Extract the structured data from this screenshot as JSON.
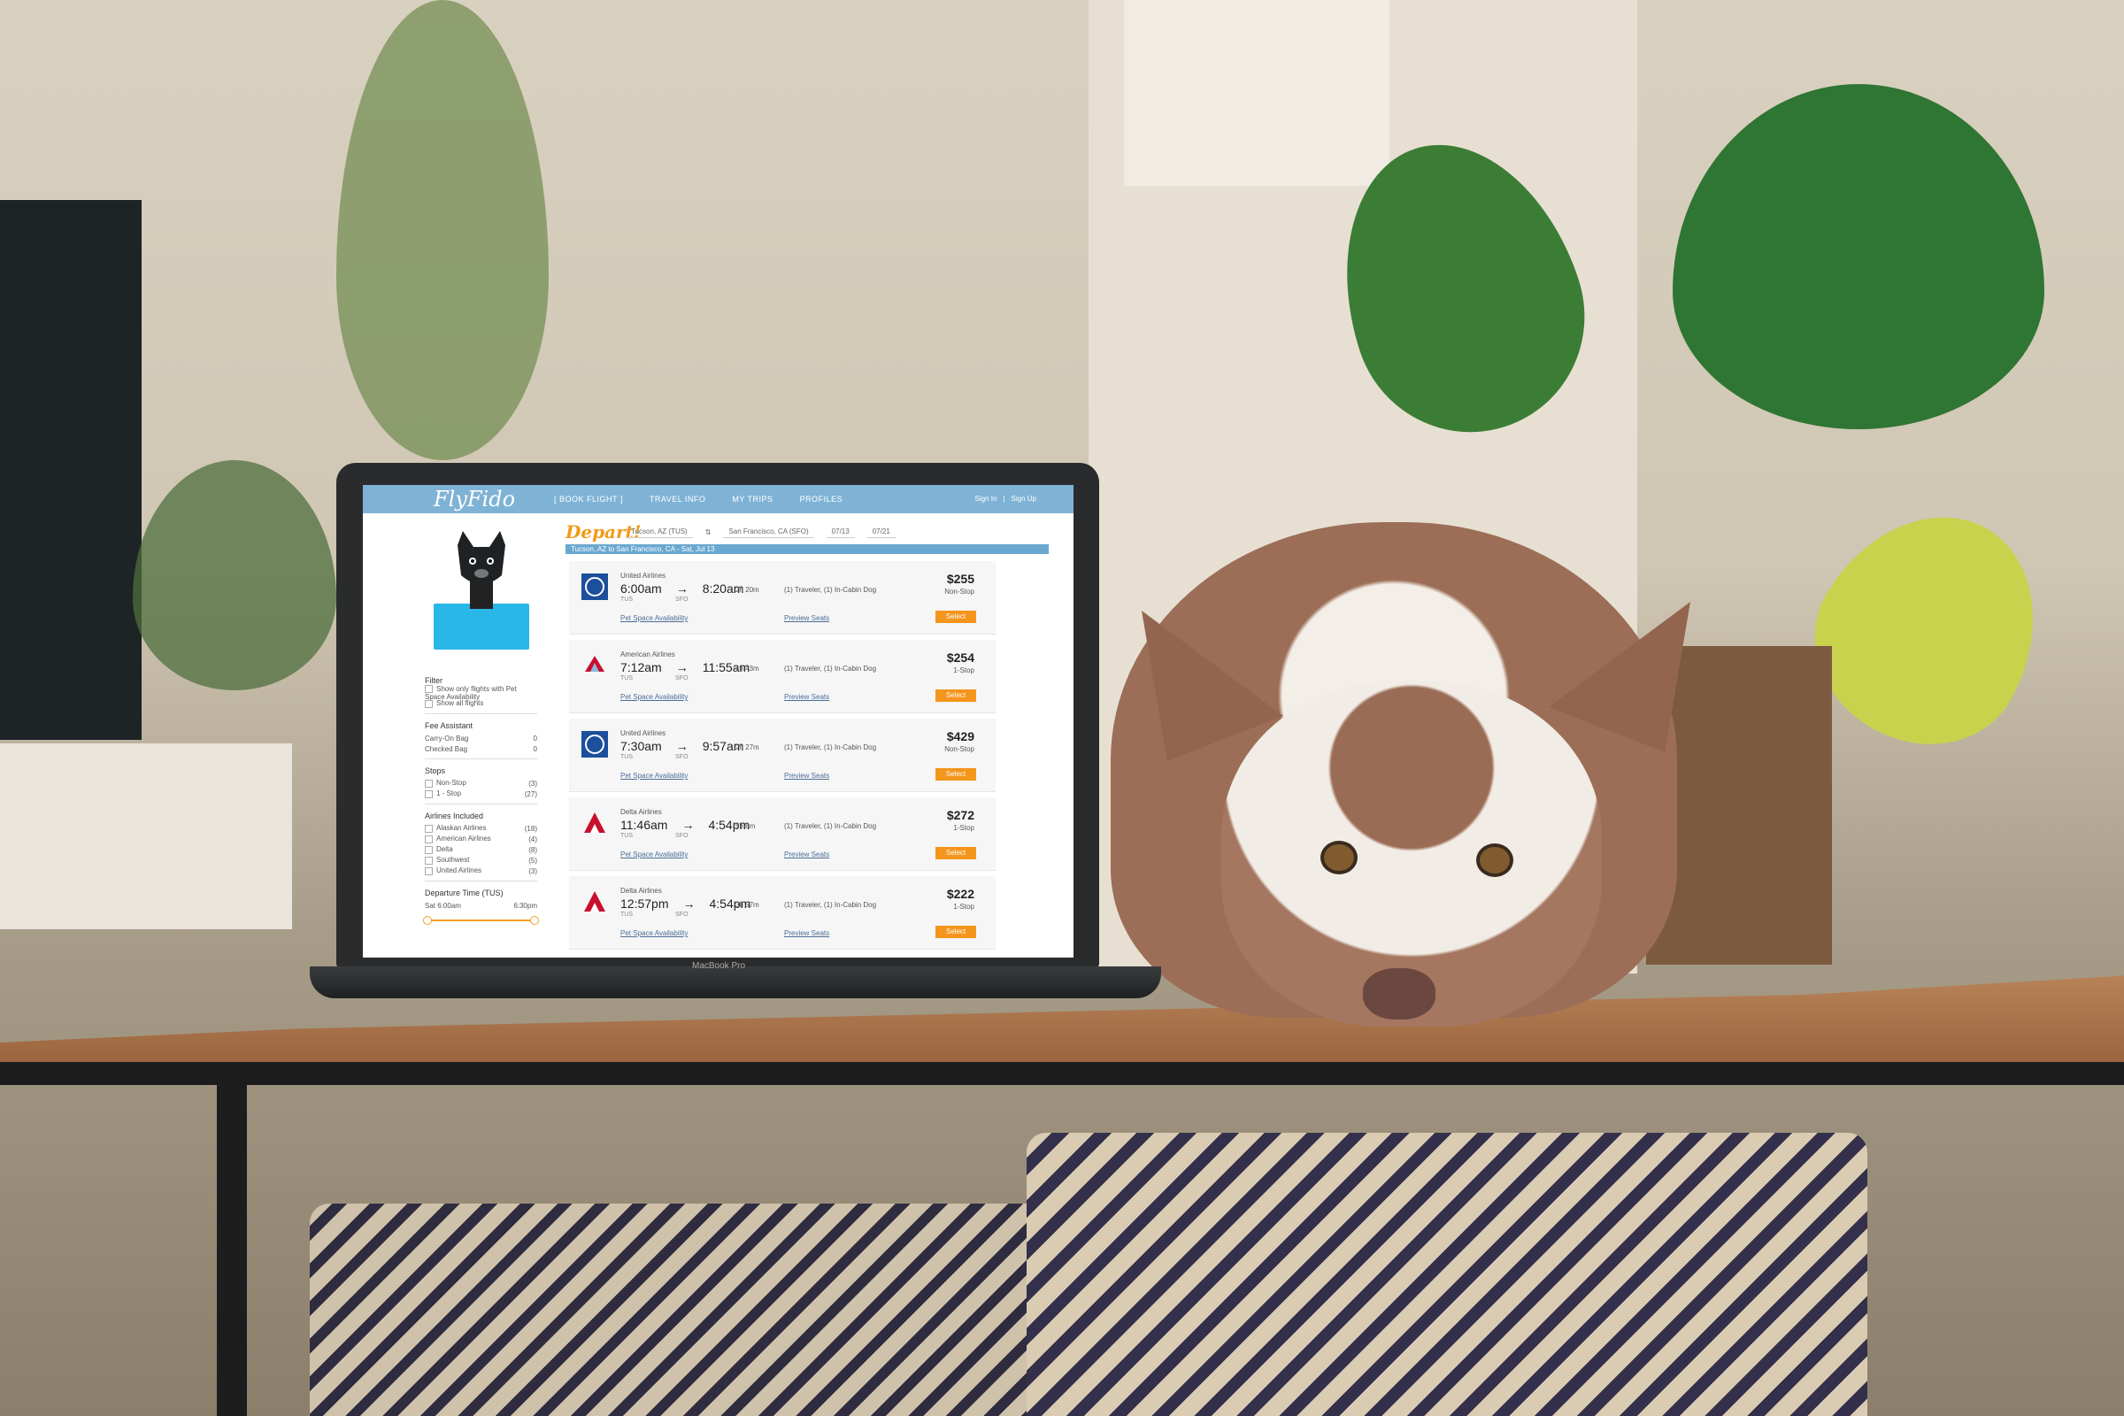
{
  "app": {
    "logo": "FlyFido",
    "nav": [
      "[ BOOK FLIGHT ]",
      "TRAVEL INFO",
      "MY TRIPS",
      "PROFILES"
    ],
    "auth": [
      "Sign In",
      "|",
      "Sign Up"
    ]
  },
  "search": {
    "depart_label": "Depart!",
    "from": "Tucson, AZ (TUS)",
    "to": "San Francisco, CA (SFO)",
    "date_out": "07/13",
    "date_back": "07/21",
    "route_bar": "Tucson, AZ to San Francisco, CA - Sat, Jul 13"
  },
  "filters": {
    "filter_title": "Filter",
    "filter_opts": [
      "Show only flights with Pet Space Availability",
      "Show all flights"
    ],
    "fee_title": "Fee Assistant",
    "fee_rows": [
      {
        "label": "Carry-On Bag",
        "value": "0"
      },
      {
        "label": "Checked Bag",
        "value": "0"
      }
    ],
    "stops_title": "Stops",
    "stops": [
      {
        "label": "Non-Stop",
        "count": "(3)"
      },
      {
        "label": "1 - Stop",
        "count": "(27)"
      }
    ],
    "airlines_title": "Airlines Included",
    "airlines": [
      {
        "label": "Alaskan Airlines",
        "count": "(18)"
      },
      {
        "label": "American Airlines",
        "count": "(4)"
      },
      {
        "label": "Delta",
        "count": "(8)"
      },
      {
        "label": "Southwest",
        "count": "(5)"
      },
      {
        "label": "United Airlines",
        "count": "(3)"
      }
    ],
    "dep_title": "Departure Time (TUS)",
    "dep_range": {
      "day": "Sat",
      "start": "6:00am",
      "end": "6:30pm",
      "start_fraction": 0.0,
      "end_fraction": 1.0
    }
  },
  "flights": [
    {
      "airline": "United Airlines",
      "dep": "6:00am",
      "arr": "8:20am",
      "from": "TUS",
      "to": "SFO",
      "dur": "2h 20m",
      "travelers": "(1) Traveler, (1) In-Cabin Dog",
      "price": "$255",
      "stops": "Non-Stop",
      "pet": "Pet Space Availability",
      "preview": "Preview Seats",
      "select": "Select",
      "logo": "united",
      "color": "#1c4f9c"
    },
    {
      "airline": "American Airlines",
      "dep": "7:12am",
      "arr": "11:55am",
      "from": "TUS",
      "to": "SFO",
      "dur": "4h 43m",
      "travelers": "(1) Traveler, (1) In-Cabin Dog",
      "price": "$254",
      "stops": "1-Stop",
      "pet": "Pet Space Availability",
      "preview": "Preview Seats",
      "select": "Select",
      "logo": "american",
      "color": "#c8102e"
    },
    {
      "airline": "United Airlines",
      "dep": "7:30am",
      "arr": "9:57am",
      "from": "TUS",
      "to": "SFO",
      "dur": "2h 27m",
      "travelers": "(1) Traveler, (1) In-Cabin Dog",
      "price": "$429",
      "stops": "Non-Stop",
      "pet": "Pet Space Availability",
      "preview": "Preview Seats",
      "select": "Select",
      "logo": "united",
      "color": "#1c4f9c"
    },
    {
      "airline": "Delta Airlines",
      "dep": "11:46am",
      "arr": "4:54pm",
      "from": "TUS",
      "to": "SFO",
      "dur": "5h 8m",
      "travelers": "(1) Traveler, (1) In-Cabin Dog",
      "price": "$272",
      "stops": "1-Stop",
      "pet": "Pet Space Availability",
      "preview": "Preview Seats",
      "select": "Select",
      "logo": "delta",
      "color": "#c8102e"
    },
    {
      "airline": "Delta Airlines",
      "dep": "12:57pm",
      "arr": "4:54pm",
      "from": "TUS",
      "to": "SFO",
      "dur": "3h 57m",
      "travelers": "(1) Traveler, (1) In-Cabin Dog",
      "price": "$222",
      "stops": "1-Stop",
      "pet": "Pet Space Availability",
      "preview": "Preview Seats",
      "select": "Select",
      "logo": "delta",
      "color": "#c8102e"
    }
  ],
  "laptop_label": "MacBook Pro"
}
